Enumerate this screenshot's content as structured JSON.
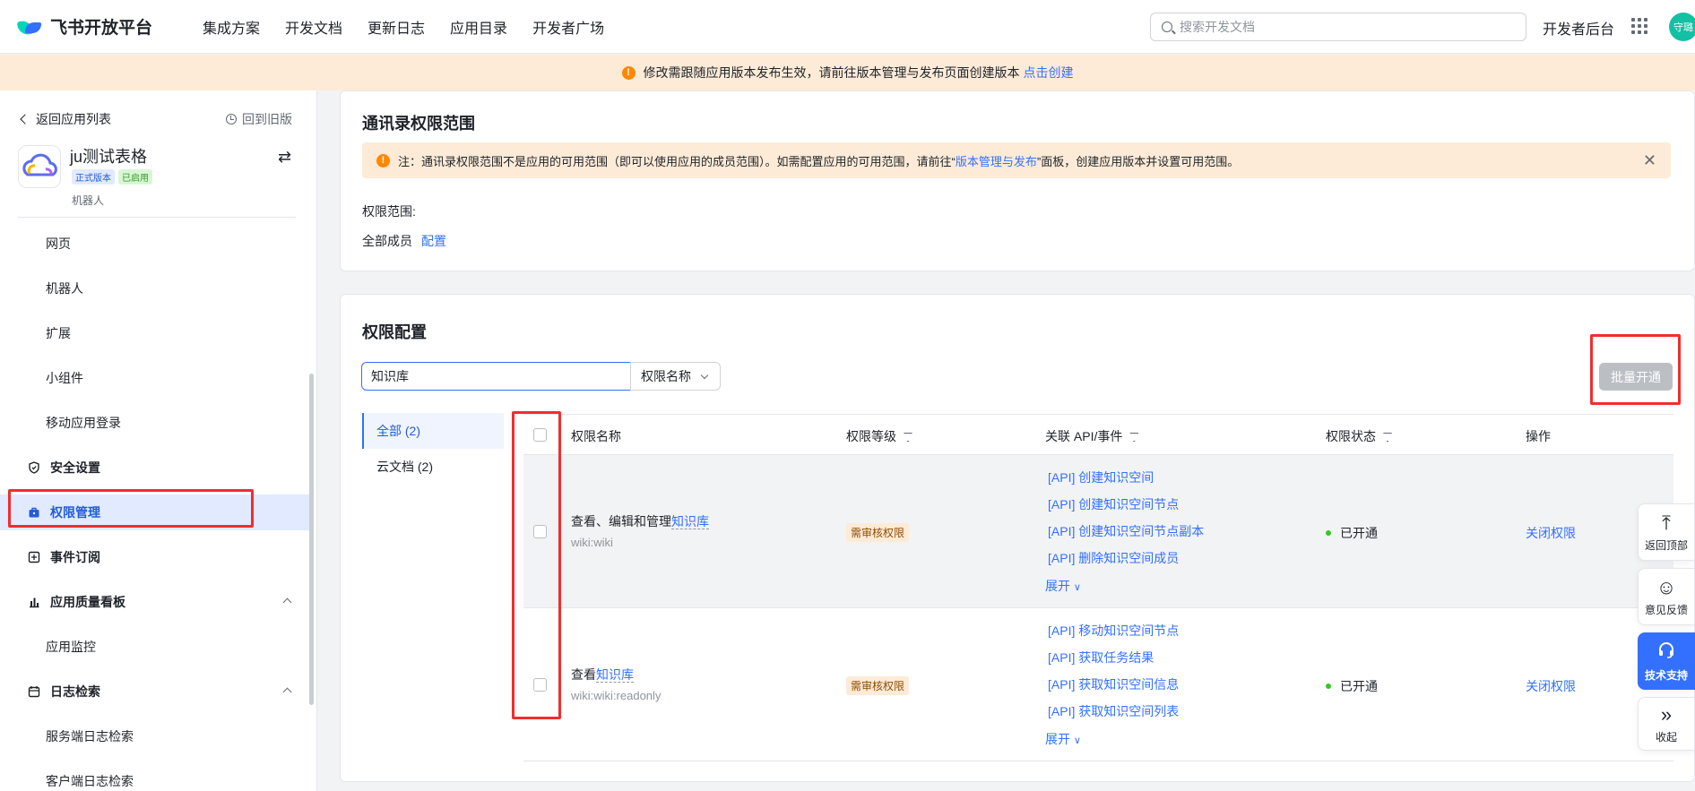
{
  "header": {
    "brand": "飞书开放平台",
    "nav": [
      "集成方案",
      "开发文档",
      "更新日志",
      "应用目录",
      "开发者广场"
    ],
    "search_placeholder": "搜索开发文档",
    "console": "开发者后台",
    "avatar": "守璐"
  },
  "notice": {
    "text": "修改需跟随应用版本发布生效，请前往版本管理与发布页面创建版本",
    "link": "点击创建"
  },
  "sidebar": {
    "back": "返回应用列表",
    "old_version": "回到旧版",
    "app_name": "ju测试表格",
    "tags": [
      "正式版本",
      "已启用"
    ],
    "app_type": "机器人",
    "items": {
      "web": "网页",
      "bot": "机器人",
      "ext": "扩展",
      "widget": "小组件",
      "mobile_login": "移动应用登录",
      "security": "安全设置",
      "permission": "权限管理",
      "events": "事件订阅",
      "quality": "应用质量看板",
      "monitor": "应用监控",
      "logs": "日志检索",
      "server_logs": "服务端日志检索",
      "client_logs": "客户端日志检索"
    }
  },
  "contacts": {
    "title": "通讯录权限范围",
    "hint_prefix": "注：通讯录权限范围不是应用的可用范围（即可以使用应用的成员范围）。如需配置应用的可用范围，请前往“",
    "hint_link": "版本管理与发布",
    "hint_suffix": "”面板，创建应用版本并设置可用范围。",
    "scope_label": "权限范围:",
    "scope_value": "全部成员",
    "scope_link": "配置"
  },
  "permissions": {
    "title": "权限配置",
    "search_value": "知识库",
    "select_value": "权限名称",
    "batch_button": "批量开通",
    "categories": [
      "全部 (2)",
      "云文档 (2)"
    ],
    "columns": [
      "权限名称",
      "权限等级",
      "关联 API/事件",
      "权限状态",
      "操作"
    ],
    "rows": [
      {
        "name_prefix": "查看、编辑和管理",
        "name_highlight": "知识库",
        "code": "wiki:wiki",
        "level": "需审核权限",
        "apis": [
          "[API] 创建知识空间",
          "[API] 创建知识空间节点",
          "[API] 创建知识空间节点副本",
          "[API] 删除知识空间成员"
        ],
        "expand": "展开",
        "status": "已开通",
        "action": "关闭权限"
      },
      {
        "name_prefix": "查看",
        "name_highlight": "知识库",
        "code": "wiki:wiki:readonly",
        "level": "需审核权限",
        "apis": [
          "[API] 移动知识空间节点",
          "[API] 获取任务结果",
          "[API] 获取知识空间信息",
          "[API] 获取知识空间列表"
        ],
        "expand": "展开",
        "status": "已开通",
        "action": "关闭权限"
      }
    ]
  },
  "float_tools": {
    "top": "返回顶部",
    "feedback": "意见反馈",
    "support": "技术支持",
    "collapse": "收起"
  }
}
